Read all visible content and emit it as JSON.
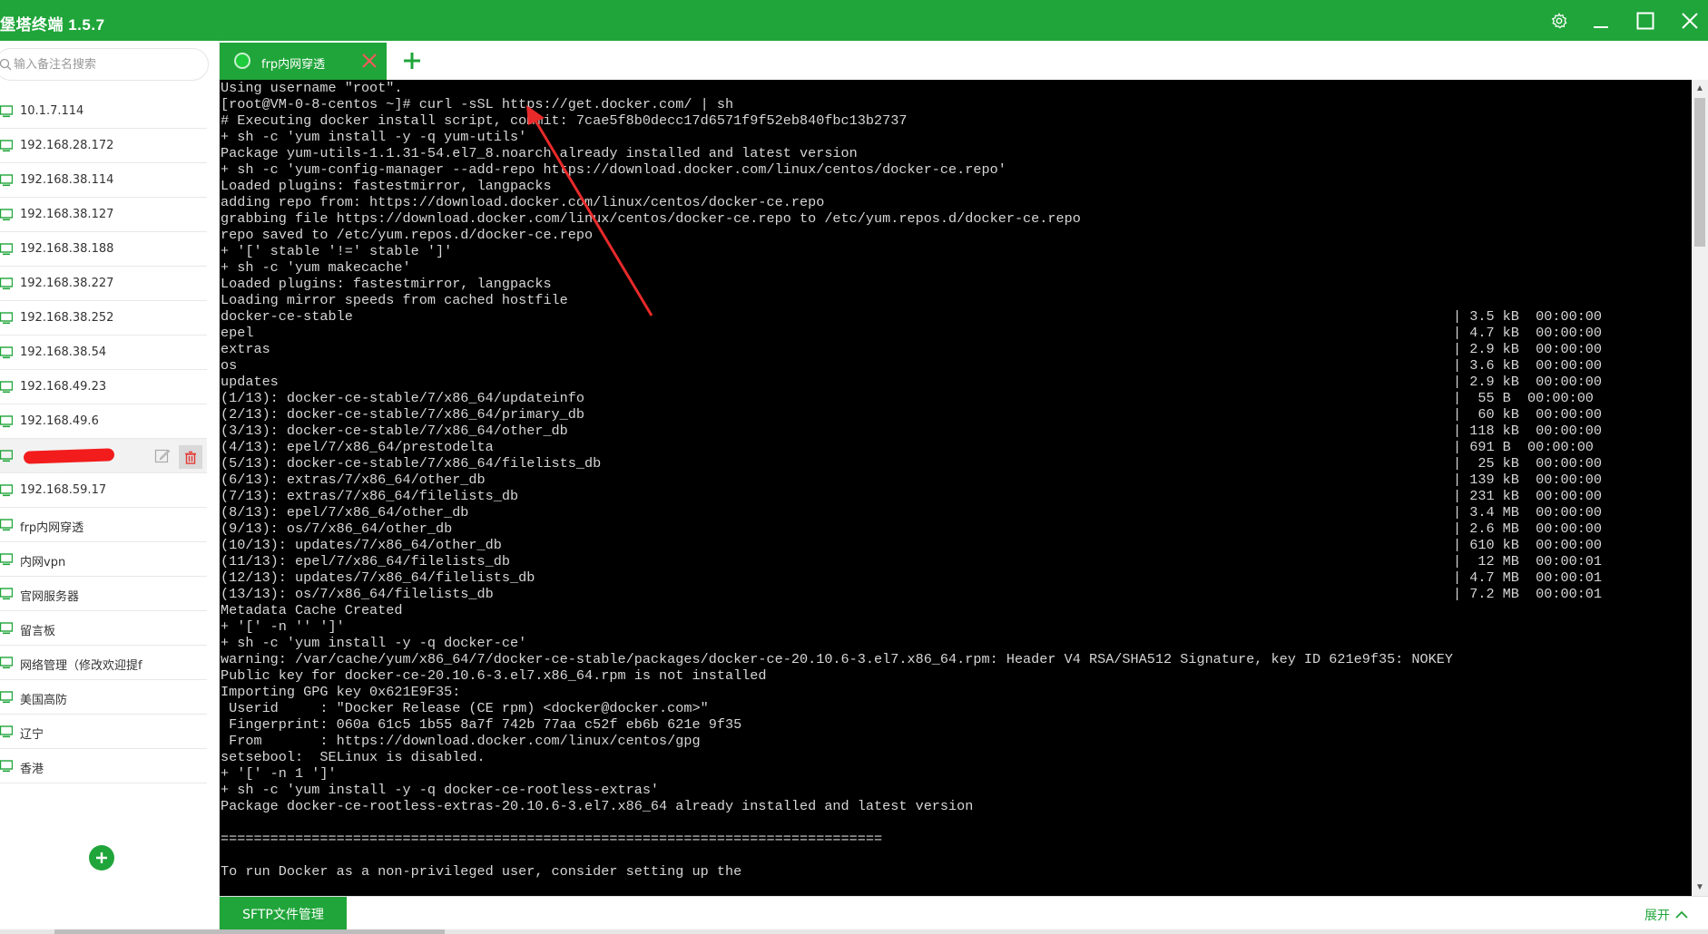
{
  "window": {
    "title": "堡塔终端 1.5.7",
    "theme_color": "#20a53a"
  },
  "search": {
    "placeholder": "输入备注名搜索"
  },
  "hosts": [
    {
      "label": "10.1.7.114"
    },
    {
      "label": "192.168.28.172"
    },
    {
      "label": "192.168.38.114"
    },
    {
      "label": "192.168.38.127"
    },
    {
      "label": "192.168.38.188"
    },
    {
      "label": "192.168.38.227"
    },
    {
      "label": "192.168.38.252"
    },
    {
      "label": "192.168.38.54"
    },
    {
      "label": "192.168.49.23"
    },
    {
      "label": "192.168.49.6"
    },
    {
      "label": ""
    },
    {
      "label": "192.168.59.17"
    },
    {
      "label": "frp内网穿透"
    },
    {
      "label": "内网vpn"
    },
    {
      "label": "官网服务器"
    },
    {
      "label": "留言板"
    },
    {
      "label": "网络管理（修改欢迎提f"
    },
    {
      "label": "美国高防"
    },
    {
      "label": "辽宁"
    },
    {
      "label": "香港"
    }
  ],
  "tabs": [
    {
      "label": "frp内网穿透"
    }
  ],
  "terminal": {
    "lines": [
      "Using username \"root\".",
      "[root@VM-0-8-centos ~]# curl -sSL https://get.docker.com/ | sh",
      "# Executing docker install script, commit: 7cae5f8b0decc17d6571f9f52eb840fbc13b2737",
      "+ sh -c 'yum install -y -q yum-utils'",
      "Package yum-utils-1.1.31-54.el7_8.noarch already installed and latest version",
      "+ sh -c 'yum-config-manager --add-repo https://download.docker.com/linux/centos/docker-ce.repo'",
      "Loaded plugins: fastestmirror, langpacks",
      "adding repo from: https://download.docker.com/linux/centos/docker-ce.repo",
      "grabbing file https://download.docker.com/linux/centos/docker-ce.repo to /etc/yum.repos.d/docker-ce.repo",
      "repo saved to /etc/yum.repos.d/docker-ce.repo",
      "+ '[' stable '!=' stable ']'",
      "+ sh -c 'yum makecache'",
      "Loaded plugins: fastestmirror, langpacks",
      "Loading mirror speeds from cached hostfile",
      "docker-ce-stable                                                                                                                                     | 3.5 kB  00:00:00",
      "epel                                                                                                                                                 | 4.7 kB  00:00:00",
      "extras                                                                                                                                               | 2.9 kB  00:00:00",
      "os                                                                                                                                                   | 3.6 kB  00:00:00",
      "updates                                                                                                                                              | 2.9 kB  00:00:00",
      "(1/13): docker-ce-stable/7/x86_64/updateinfo                                                                                                         |  55 B  00:00:00",
      "(2/13): docker-ce-stable/7/x86_64/primary_db                                                                                                         |  60 kB  00:00:00",
      "(3/13): docker-ce-stable/7/x86_64/other_db                                                                                                           | 118 kB  00:00:00",
      "(4/13): epel/7/x86_64/prestodelta                                                                                                                    | 691 B  00:00:00",
      "(5/13): docker-ce-stable/7/x86_64/filelists_db                                                                                                       |  25 kB  00:00:00",
      "(6/13): extras/7/x86_64/other_db                                                                                                                     | 139 kB  00:00:00",
      "(7/13): extras/7/x86_64/filelists_db                                                                                                                 | 231 kB  00:00:00",
      "(8/13): epel/7/x86_64/other_db                                                                                                                       | 3.4 MB  00:00:00",
      "(9/13): os/7/x86_64/other_db                                                                                                                         | 2.6 MB  00:00:00",
      "(10/13): updates/7/x86_64/other_db                                                                                                                   | 610 kB  00:00:00",
      "(11/13): epel/7/x86_64/filelists_db                                                                                                                  |  12 MB  00:00:01",
      "(12/13): updates/7/x86_64/filelists_db                                                                                                               | 4.7 MB  00:00:01",
      "(13/13): os/7/x86_64/filelists_db                                                                                                                    | 7.2 MB  00:00:01",
      "Metadata Cache Created",
      "+ '[' -n '' ']'",
      "+ sh -c 'yum install -y -q docker-ce'",
      "warning: /var/cache/yum/x86_64/7/docker-ce-stable/packages/docker-ce-20.10.6-3.el7.x86_64.rpm: Header V4 RSA/SHA512 Signature, key ID 621e9f35: NOKEY",
      "Public key for docker-ce-20.10.6-3.el7.x86_64.rpm is not installed",
      "Importing GPG key 0x621E9F35:",
      " Userid     : \"Docker Release (CE rpm) <docker@docker.com>\"",
      " Fingerprint: 060a 61c5 1b55 8a7f 742b 77aa c52f eb6b 621e 9f35",
      " From       : https://download.docker.com/linux/centos/gpg",
      "setsebool:  SELinux is disabled.",
      "+ '[' -n 1 ']'",
      "+ sh -c 'yum install -y -q docker-ce-rootless-extras'",
      "Package docker-ce-rootless-extras-20.10.6-3.el7.x86_64 already installed and latest version",
      "",
      "================================================================================",
      "",
      "To run Docker as a non-privileged user, consider setting up the"
    ]
  },
  "bottom": {
    "sftp_label": "SFTP文件管理",
    "expand_label": "展开"
  }
}
